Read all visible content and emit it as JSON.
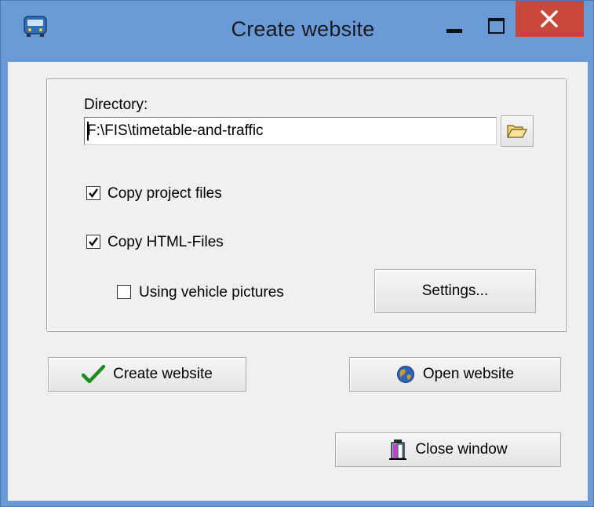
{
  "window": {
    "title": "Create website",
    "app_icon": "bus-icon",
    "controls": [
      "minimize",
      "maximize",
      "close"
    ]
  },
  "directory": {
    "label": "Directory:",
    "value": "F:\\FIS\\timetable-and-traffic",
    "browse_icon": "folder-open-icon"
  },
  "options": {
    "copy_project_files": {
      "label": "Copy project files",
      "checked": true
    },
    "copy_html_files": {
      "label": "Copy HTML-Files",
      "checked": true
    },
    "using_vehicle_pictures": {
      "label": "Using vehicle pictures",
      "checked": false
    }
  },
  "buttons": {
    "settings": "Settings...",
    "create_website": "Create website",
    "open_website": "Open website",
    "close_window": "Close window"
  },
  "colors": {
    "titlebar": "#6a9bd8",
    "close_button": "#c9463d",
    "client_bg": "#f0f0f0",
    "check_green": "#1f8a1f"
  }
}
